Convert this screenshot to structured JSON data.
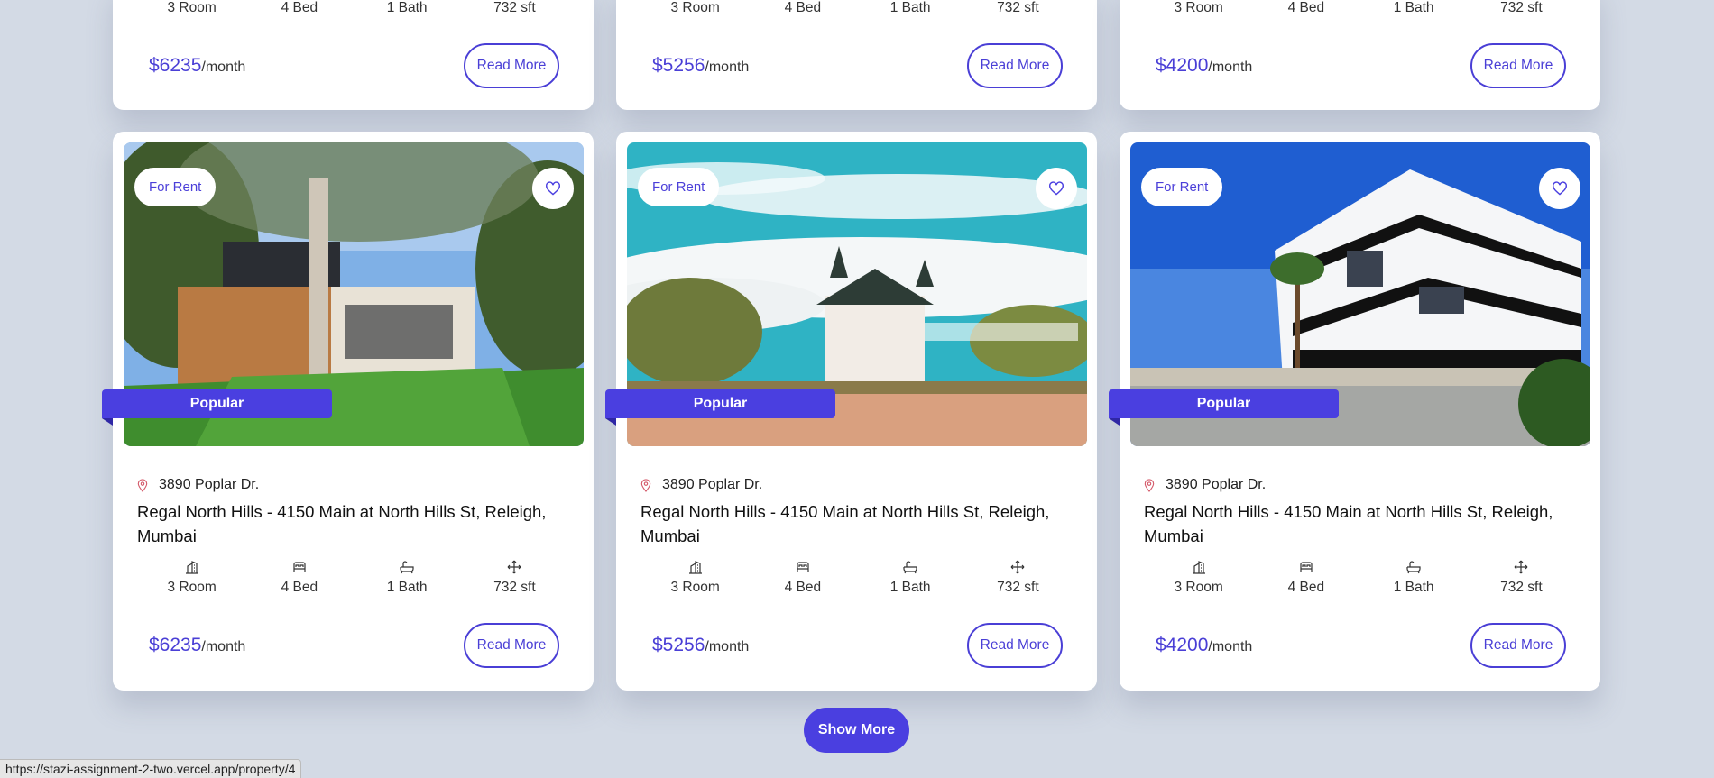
{
  "top_cards": [
    {
      "rooms": "3 Room",
      "beds": "4 Bed",
      "baths": "1 Bath",
      "area": "732 sft",
      "price": "$6235",
      "per": "/month",
      "cta": "Read More"
    },
    {
      "rooms": "3 Room",
      "beds": "4 Bed",
      "baths": "1 Bath",
      "area": "732 sft",
      "price": "$5256",
      "per": "/month",
      "cta": "Read More"
    },
    {
      "rooms": "3 Room",
      "beds": "4 Bed",
      "baths": "1 Bath",
      "area": "732 sft",
      "price": "$4200",
      "per": "/month",
      "cta": "Read More"
    }
  ],
  "cards": [
    {
      "tag": "For Rent",
      "badge": "Popular",
      "address": "3890 Poplar Dr.",
      "title": "Regal North Hills - 4150 Main at North Hills St, Releigh, Mumbai",
      "rooms": "3 Room",
      "beds": "4 Bed",
      "baths": "1 Bath",
      "area": "732 sft",
      "price": "$6235",
      "per": "/month",
      "cta": "Read More"
    },
    {
      "tag": "For Rent",
      "badge": "Popular",
      "address": "3890 Poplar Dr.",
      "title": "Regal North Hills - 4150 Main at North Hills St, Releigh, Mumbai",
      "rooms": "3 Room",
      "beds": "4 Bed",
      "baths": "1 Bath",
      "area": "732 sft",
      "price": "$5256",
      "per": "/month",
      "cta": "Read More"
    },
    {
      "tag": "For Rent",
      "badge": "Popular",
      "address": "3890 Poplar Dr.",
      "title": "Regal North Hills - 4150 Main at North Hills St, Releigh, Mumbai",
      "rooms": "3 Room",
      "beds": "4 Bed",
      "baths": "1 Bath",
      "area": "732 sft",
      "price": "$4200",
      "per": "/month",
      "cta": "Read More"
    }
  ],
  "show_more": "Show More",
  "status_url": "https://stazi-assignment-2-two.vercel.app/property/4",
  "icons": {
    "location": "location-pin-icon",
    "heart": "heart-icon",
    "rooms": "building-icon",
    "beds": "bed-icon",
    "baths": "bathtub-icon",
    "area": "move-arrows-icon"
  },
  "colors": {
    "accent": "#4a3fe0",
    "background": "#d3dae5",
    "card": "#ffffff"
  }
}
